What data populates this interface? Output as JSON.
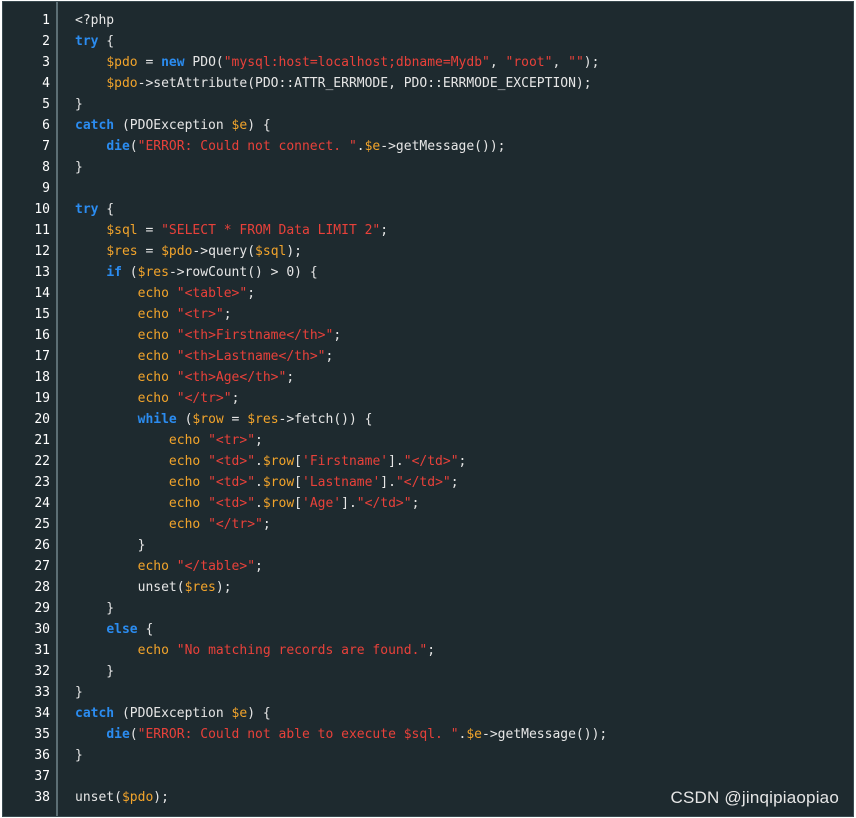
{
  "watermark": "CSDN @jinqipiaopiao",
  "lines": [
    [
      {
        "t": "<?php",
        "c": "plain"
      }
    ],
    [
      {
        "t": "try",
        "c": "kw"
      },
      {
        "t": " {",
        "c": "plain"
      }
    ],
    [
      {
        "t": "    ",
        "c": "plain"
      },
      {
        "t": "$pdo",
        "c": "var"
      },
      {
        "t": " = ",
        "c": "plain"
      },
      {
        "t": "new",
        "c": "kw"
      },
      {
        "t": " PDO(",
        "c": "plain"
      },
      {
        "t": "\"mysql:host=localhost;dbname=Mydb\"",
        "c": "str"
      },
      {
        "t": ", ",
        "c": "plain"
      },
      {
        "t": "\"root\"",
        "c": "str"
      },
      {
        "t": ", ",
        "c": "plain"
      },
      {
        "t": "\"\"",
        "c": "str"
      },
      {
        "t": ");",
        "c": "plain"
      }
    ],
    [
      {
        "t": "    ",
        "c": "plain"
      },
      {
        "t": "$pdo",
        "c": "var"
      },
      {
        "t": "->setAttribute(PDO::ATTR_ERRMODE, PDO::ERRMODE_EXCEPTION);",
        "c": "plain"
      }
    ],
    [
      {
        "t": "}",
        "c": "plain"
      }
    ],
    [
      {
        "t": "catch",
        "c": "kw"
      },
      {
        "t": " (PDOException ",
        "c": "plain"
      },
      {
        "t": "$e",
        "c": "var"
      },
      {
        "t": ") {",
        "c": "plain"
      }
    ],
    [
      {
        "t": "    ",
        "c": "plain"
      },
      {
        "t": "die",
        "c": "kw"
      },
      {
        "t": "(",
        "c": "plain"
      },
      {
        "t": "\"ERROR: Could not connect. \"",
        "c": "str"
      },
      {
        "t": ".",
        "c": "plain"
      },
      {
        "t": "$e",
        "c": "var"
      },
      {
        "t": "->getMessage());",
        "c": "plain"
      }
    ],
    [
      {
        "t": "}",
        "c": "plain"
      }
    ],
    [],
    [
      {
        "t": "try",
        "c": "kw"
      },
      {
        "t": " {",
        "c": "plain"
      }
    ],
    [
      {
        "t": "    ",
        "c": "plain"
      },
      {
        "t": "$sql",
        "c": "var"
      },
      {
        "t": " = ",
        "c": "plain"
      },
      {
        "t": "\"SELECT * FROM Data LIMIT 2\"",
        "c": "str"
      },
      {
        "t": ";",
        "c": "plain"
      }
    ],
    [
      {
        "t": "    ",
        "c": "plain"
      },
      {
        "t": "$res",
        "c": "var"
      },
      {
        "t": " = ",
        "c": "plain"
      },
      {
        "t": "$pdo",
        "c": "var"
      },
      {
        "t": "->query(",
        "c": "plain"
      },
      {
        "t": "$sql",
        "c": "var"
      },
      {
        "t": ");",
        "c": "plain"
      }
    ],
    [
      {
        "t": "    ",
        "c": "plain"
      },
      {
        "t": "if",
        "c": "kw"
      },
      {
        "t": " (",
        "c": "plain"
      },
      {
        "t": "$res",
        "c": "var"
      },
      {
        "t": "->rowCount() > 0) {",
        "c": "plain"
      }
    ],
    [
      {
        "t": "        ",
        "c": "plain"
      },
      {
        "t": "echo",
        "c": "fn"
      },
      {
        "t": " ",
        "c": "plain"
      },
      {
        "t": "\"<table>\"",
        "c": "str"
      },
      {
        "t": ";",
        "c": "plain"
      }
    ],
    [
      {
        "t": "        ",
        "c": "plain"
      },
      {
        "t": "echo",
        "c": "fn"
      },
      {
        "t": " ",
        "c": "plain"
      },
      {
        "t": "\"<tr>\"",
        "c": "str"
      },
      {
        "t": ";",
        "c": "plain"
      }
    ],
    [
      {
        "t": "        ",
        "c": "plain"
      },
      {
        "t": "echo",
        "c": "fn"
      },
      {
        "t": " ",
        "c": "plain"
      },
      {
        "t": "\"<th>Firstname</th>\"",
        "c": "str"
      },
      {
        "t": ";",
        "c": "plain"
      }
    ],
    [
      {
        "t": "        ",
        "c": "plain"
      },
      {
        "t": "echo",
        "c": "fn"
      },
      {
        "t": " ",
        "c": "plain"
      },
      {
        "t": "\"<th>Lastname</th>\"",
        "c": "str"
      },
      {
        "t": ";",
        "c": "plain"
      }
    ],
    [
      {
        "t": "        ",
        "c": "plain"
      },
      {
        "t": "echo",
        "c": "fn"
      },
      {
        "t": " ",
        "c": "plain"
      },
      {
        "t": "\"<th>Age</th>\"",
        "c": "str"
      },
      {
        "t": ";",
        "c": "plain"
      }
    ],
    [
      {
        "t": "        ",
        "c": "plain"
      },
      {
        "t": "echo",
        "c": "fn"
      },
      {
        "t": " ",
        "c": "plain"
      },
      {
        "t": "\"</tr>\"",
        "c": "str"
      },
      {
        "t": ";",
        "c": "plain"
      }
    ],
    [
      {
        "t": "        ",
        "c": "plain"
      },
      {
        "t": "while",
        "c": "kw"
      },
      {
        "t": " (",
        "c": "plain"
      },
      {
        "t": "$row",
        "c": "var"
      },
      {
        "t": " = ",
        "c": "plain"
      },
      {
        "t": "$res",
        "c": "var"
      },
      {
        "t": "->fetch()) {",
        "c": "plain"
      }
    ],
    [
      {
        "t": "            ",
        "c": "plain"
      },
      {
        "t": "echo",
        "c": "fn"
      },
      {
        "t": " ",
        "c": "plain"
      },
      {
        "t": "\"<tr>\"",
        "c": "str"
      },
      {
        "t": ";",
        "c": "plain"
      }
    ],
    [
      {
        "t": "            ",
        "c": "plain"
      },
      {
        "t": "echo",
        "c": "fn"
      },
      {
        "t": " ",
        "c": "plain"
      },
      {
        "t": "\"<td>\"",
        "c": "str"
      },
      {
        "t": ".",
        "c": "plain"
      },
      {
        "t": "$row",
        "c": "var"
      },
      {
        "t": "[",
        "c": "plain"
      },
      {
        "t": "'Firstname'",
        "c": "str"
      },
      {
        "t": "].",
        "c": "plain"
      },
      {
        "t": "\"</td>\"",
        "c": "str"
      },
      {
        "t": ";",
        "c": "plain"
      }
    ],
    [
      {
        "t": "            ",
        "c": "plain"
      },
      {
        "t": "echo",
        "c": "fn"
      },
      {
        "t": " ",
        "c": "plain"
      },
      {
        "t": "\"<td>\"",
        "c": "str"
      },
      {
        "t": ".",
        "c": "plain"
      },
      {
        "t": "$row",
        "c": "var"
      },
      {
        "t": "[",
        "c": "plain"
      },
      {
        "t": "'Lastname'",
        "c": "str"
      },
      {
        "t": "].",
        "c": "plain"
      },
      {
        "t": "\"</td>\"",
        "c": "str"
      },
      {
        "t": ";",
        "c": "plain"
      }
    ],
    [
      {
        "t": "            ",
        "c": "plain"
      },
      {
        "t": "echo",
        "c": "fn"
      },
      {
        "t": " ",
        "c": "plain"
      },
      {
        "t": "\"<td>\"",
        "c": "str"
      },
      {
        "t": ".",
        "c": "plain"
      },
      {
        "t": "$row",
        "c": "var"
      },
      {
        "t": "[",
        "c": "plain"
      },
      {
        "t": "'Age'",
        "c": "str"
      },
      {
        "t": "].",
        "c": "plain"
      },
      {
        "t": "\"</td>\"",
        "c": "str"
      },
      {
        "t": ";",
        "c": "plain"
      }
    ],
    [
      {
        "t": "            ",
        "c": "plain"
      },
      {
        "t": "echo",
        "c": "fn"
      },
      {
        "t": " ",
        "c": "plain"
      },
      {
        "t": "\"</tr>\"",
        "c": "str"
      },
      {
        "t": ";",
        "c": "plain"
      }
    ],
    [
      {
        "t": "        }",
        "c": "plain"
      }
    ],
    [
      {
        "t": "        ",
        "c": "plain"
      },
      {
        "t": "echo",
        "c": "fn"
      },
      {
        "t": " ",
        "c": "plain"
      },
      {
        "t": "\"</table>\"",
        "c": "str"
      },
      {
        "t": ";",
        "c": "plain"
      }
    ],
    [
      {
        "t": "        unset(",
        "c": "plain"
      },
      {
        "t": "$res",
        "c": "var"
      },
      {
        "t": ");",
        "c": "plain"
      }
    ],
    [
      {
        "t": "    }",
        "c": "plain"
      }
    ],
    [
      {
        "t": "    ",
        "c": "plain"
      },
      {
        "t": "else",
        "c": "kw"
      },
      {
        "t": " {",
        "c": "plain"
      }
    ],
    [
      {
        "t": "        ",
        "c": "plain"
      },
      {
        "t": "echo",
        "c": "fn"
      },
      {
        "t": " ",
        "c": "plain"
      },
      {
        "t": "\"No matching records are found.\"",
        "c": "str"
      },
      {
        "t": ";",
        "c": "plain"
      }
    ],
    [
      {
        "t": "    }",
        "c": "plain"
      }
    ],
    [
      {
        "t": "}",
        "c": "plain"
      }
    ],
    [
      {
        "t": "catch",
        "c": "kw"
      },
      {
        "t": " (PDOException ",
        "c": "plain"
      },
      {
        "t": "$e",
        "c": "var"
      },
      {
        "t": ") {",
        "c": "plain"
      }
    ],
    [
      {
        "t": "    ",
        "c": "plain"
      },
      {
        "t": "die",
        "c": "kw"
      },
      {
        "t": "(",
        "c": "plain"
      },
      {
        "t": "\"ERROR: Could not able to execute $sql. \"",
        "c": "str"
      },
      {
        "t": ".",
        "c": "plain"
      },
      {
        "t": "$e",
        "c": "var"
      },
      {
        "t": "->getMessage());",
        "c": "plain"
      }
    ],
    [
      {
        "t": "}",
        "c": "plain"
      }
    ],
    [],
    [
      {
        "t": "unset(",
        "c": "plain"
      },
      {
        "t": "$pdo",
        "c": "var"
      },
      {
        "t": ");",
        "c": "plain"
      }
    ]
  ]
}
